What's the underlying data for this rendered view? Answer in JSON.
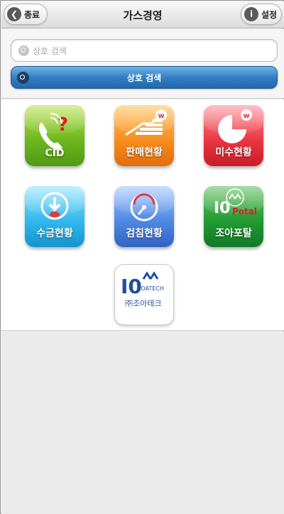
{
  "header": {
    "title": "가스경영",
    "back_label": "종료",
    "back_icon": "chevron-left-icon",
    "settings_label": "설정",
    "settings_icon": "info-icon"
  },
  "search": {
    "placeholder": "상호 검색",
    "value": "",
    "button_label": "상호 검색"
  },
  "tiles": [
    {
      "label": "CID",
      "icon": "phone-question-icon",
      "color": "#7cc22b"
    },
    {
      "label": "판매현황",
      "icon": "sales-chart-icon",
      "color": "#f68b1c"
    },
    {
      "label": "미수현황",
      "icon": "pie-chart-icon",
      "color": "#e8343f"
    },
    {
      "label": "수금현황",
      "icon": "collection-download-icon",
      "color": "#2fb6ea"
    },
    {
      "label": "검침현황",
      "icon": "gauge-icon",
      "color": "#4d86e0"
    },
    {
      "label": "조아포탈",
      "icon": "joa-portal-logo-icon",
      "color": "#1f9a31",
      "logo_text": "Potal"
    },
    {
      "label": "",
      "icon": "joatech-logo-icon",
      "color": "#ffffff",
      "logo_text": "JOATECH",
      "company_text": "㈜조아테크"
    }
  ]
}
